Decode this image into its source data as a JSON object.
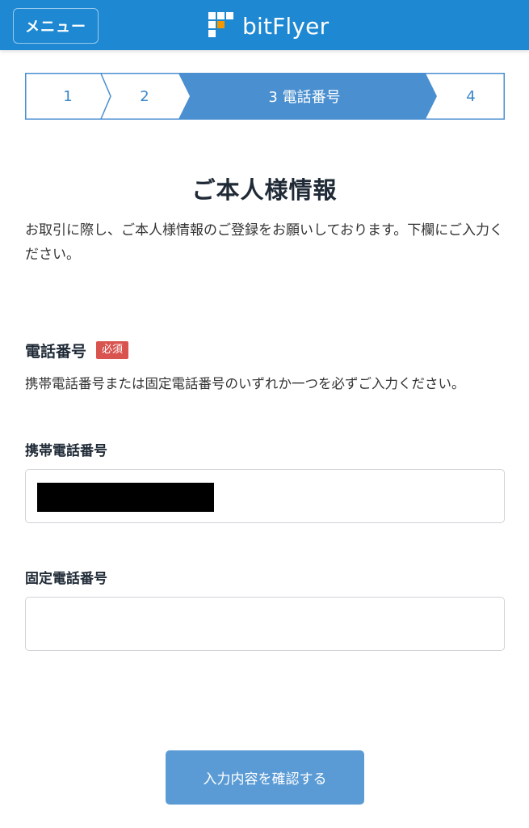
{
  "header": {
    "menu_label": "メニュー",
    "brand": "bitFlyer",
    "bg_color": "#1e88d2"
  },
  "stepper": {
    "steps": [
      {
        "label": "1",
        "active": false
      },
      {
        "label": "2",
        "active": false
      },
      {
        "label": "3 電話番号",
        "active": true
      },
      {
        "label": "4",
        "active": false
      }
    ],
    "active_color": "#4a8fd0",
    "border_color": "#4a8fd0"
  },
  "page_title": "ご本人様情報",
  "intro_text": "お取引に際し、ご本人様情報のご登録をお願いしております。下欄にご入力ください。",
  "phone_section": {
    "title": "電話番号",
    "required_badge": "必須",
    "note": "携帯電話番号または固定電話番号のいずれか一つを必ずご入力ください。",
    "mobile": {
      "label": "携帯電話番号",
      "value": ""
    },
    "landline": {
      "label": "固定電話番号",
      "value": ""
    }
  },
  "submit_label": "入力内容を確認する"
}
